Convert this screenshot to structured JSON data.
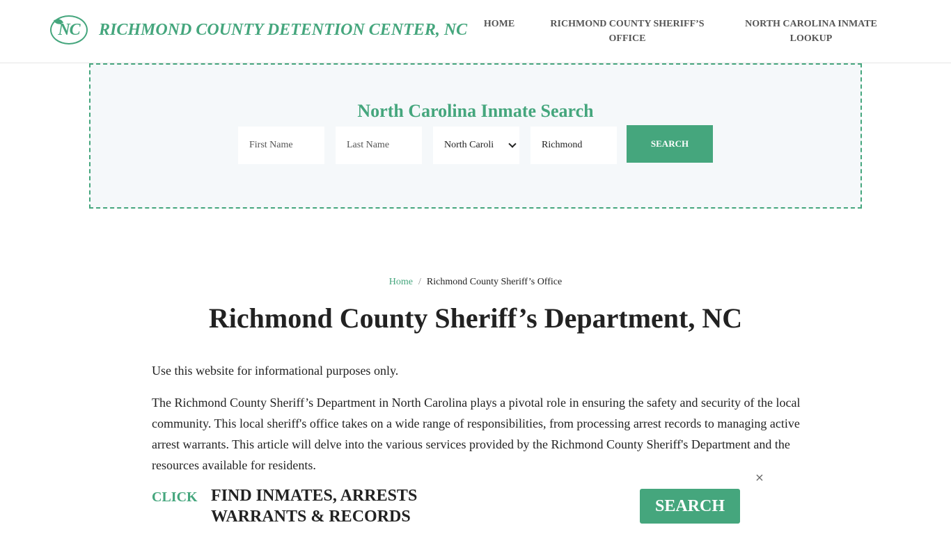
{
  "header": {
    "logo_text": "NC",
    "site_title": "RICHMOND COUNTY DETENTION CENTER, NC",
    "nav": {
      "home": "HOME",
      "sheriff_line1": "RICHMOND COUNTY SHERIFF’S",
      "sheriff_line2": "OFFICE",
      "lookup_line1": "NORTH CAROLINA INMATE",
      "lookup_line2": "LOOKUP"
    }
  },
  "search": {
    "title": "North Carolina Inmate Search",
    "first_name_placeholder": "First Name",
    "last_name_placeholder": "Last Name",
    "state_selected": "North Caroli",
    "county_value": "Richmond",
    "button_label": "SEARCH"
  },
  "breadcrumb": {
    "home": "Home",
    "separator": "/",
    "current": "Richmond County Sheriff’s Office"
  },
  "page": {
    "title": "Richmond County Sheriff’s Department, NC",
    "paragraph1": "Use this website for informational purposes only.",
    "paragraph2": "The Richmond County Sheriff’s Department in North Carolina plays a pivotal role in ensuring the safety and security of the local community. This local sheriff's office takes on a wide range of responsibilities, from processing arrest records to managing active arrest warrants. This article will delve into the various services provided by the Richmond County Sheriff's Department and the resources available for residents."
  },
  "banner": {
    "click_label": "CLICK",
    "line1": "FIND INMATES, ARRESTS",
    "line2": "WARRANTS & RECORDS",
    "button_label": "SEARCH",
    "close_symbol": "×"
  },
  "colors": {
    "brand_green": "#45a67d",
    "panel_bg": "#f5f8fa",
    "text_dark": "#222222"
  }
}
